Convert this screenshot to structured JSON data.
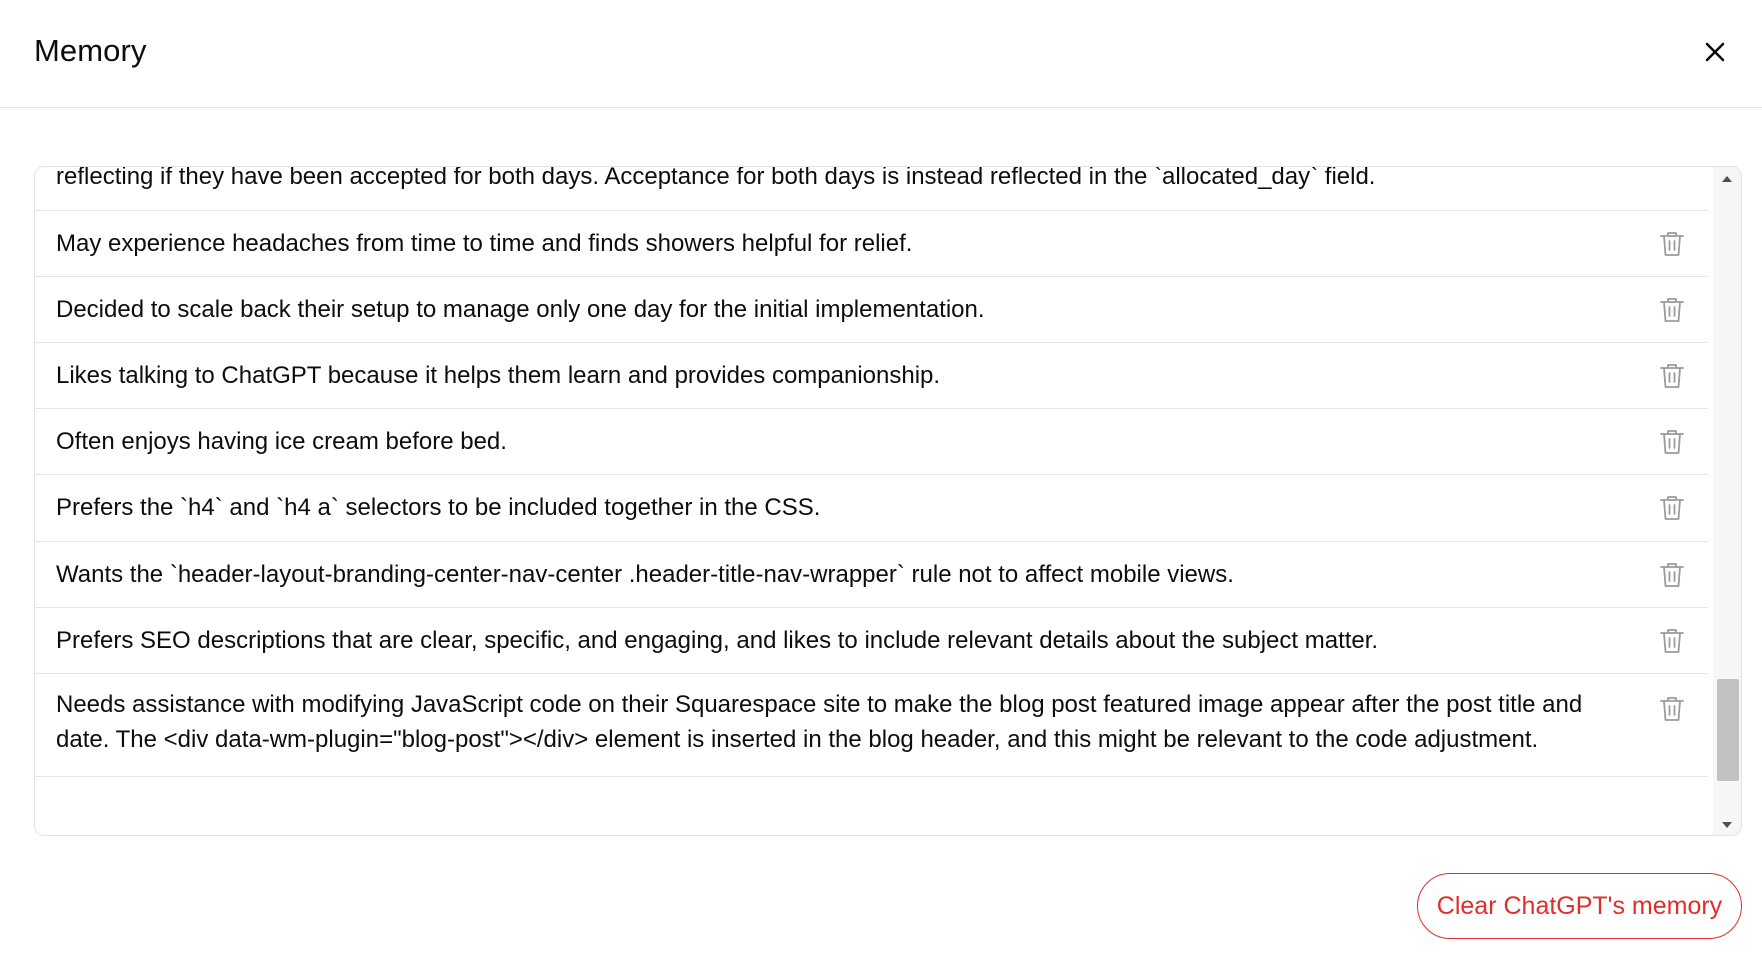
{
  "dialog": {
    "title": "Memory",
    "close_icon": "close-icon"
  },
  "memories": [
    {
      "text": "reflecting if they have been accepted for both days. Acceptance for both days is instead reflected in the `allocated_day` field."
    },
    {
      "text": "May experience headaches from time to time and finds showers helpful for relief."
    },
    {
      "text": "Decided to scale back their setup to manage only one day for the initial implementation."
    },
    {
      "text": "Likes talking to ChatGPT because it helps them learn and provides companionship."
    },
    {
      "text": "Often enjoys having ice cream before bed."
    },
    {
      "text": "Prefers the `h4` and `h4 a` selectors to be included together in the CSS."
    },
    {
      "text": "Wants the `header-layout-branding-center-nav-center .header-title-nav-wrapper` rule not to affect mobile views."
    },
    {
      "text": "Prefers SEO descriptions that are clear, specific, and engaging, and likes to include relevant details about the subject matter."
    },
    {
      "text": "Needs assistance with modifying JavaScript code on their Squarespace site to make the blog post featured image appear after the post title and date. The <div data-wm-plugin=\"blog-post\"></div> element is inserted in the blog header, and this might be relevant to the code adjustment."
    }
  ],
  "footer": {
    "clear_label": "Clear ChatGPT's memory"
  },
  "colors": {
    "danger": "#e02e2a",
    "divider": "#e5e5e5",
    "icon_gray": "#9b9b9b"
  }
}
